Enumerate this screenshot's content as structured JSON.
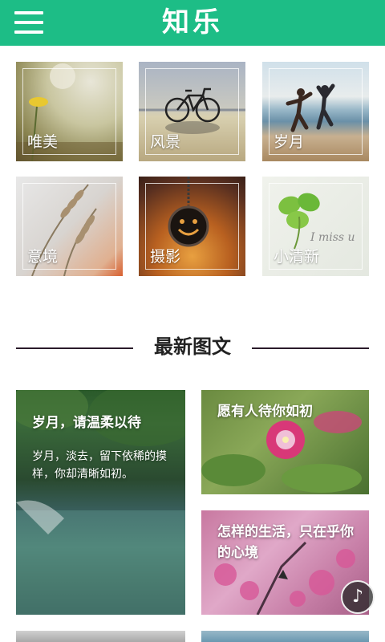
{
  "header": {
    "title": "知乐",
    "menu_icon": "menu-icon"
  },
  "categories": [
    {
      "label": "唯美"
    },
    {
      "label": "风景"
    },
    {
      "label": "岁月"
    },
    {
      "label": "意境"
    },
    {
      "label": "摄影"
    },
    {
      "label": "小清新"
    }
  ],
  "section": {
    "title": "最新图文"
  },
  "articles": [
    {
      "title": "岁月，请温柔以待",
      "excerpt": "岁月，淡去，留下依稀的摸样，你却清晰如初。"
    },
    {
      "title": "愿有人待你如初",
      "excerpt": ""
    },
    {
      "title": "怎样的生活，只在乎你的心境",
      "excerpt": ""
    }
  ],
  "music_button": {
    "icon": "music-note-icon",
    "glyph": "♪"
  },
  "colors": {
    "header_bg": "#1dbd86",
    "section_line": "#2a1a2a"
  }
}
